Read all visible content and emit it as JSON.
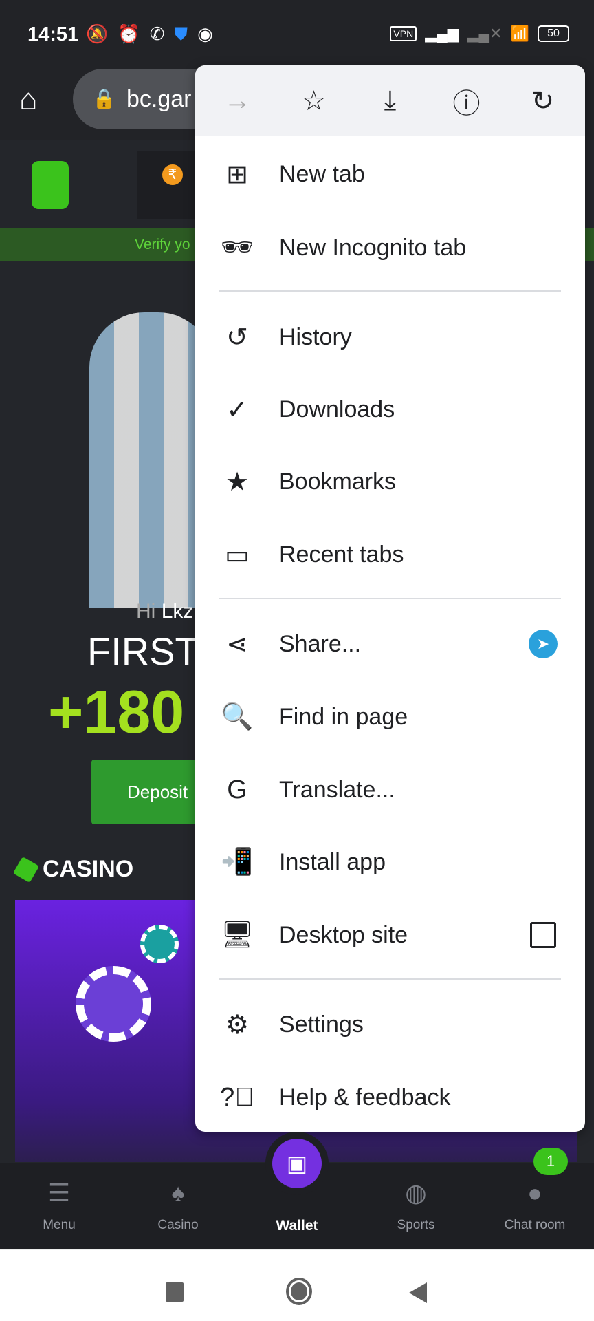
{
  "status_bar": {
    "time": "14:51",
    "vpn": "VPN",
    "battery": "50",
    "left_icons": [
      "mute-bell-icon",
      "alarm-icon",
      "whatsapp-icon",
      "shield-icon",
      "chrome-icon"
    ]
  },
  "browser": {
    "url": "bc.gar"
  },
  "site": {
    "verify_text": "Verify yo",
    "greeting_hi": "Hi",
    "greeting_name": "Lkz",
    "headline": "FIRST",
    "bonus": "+180",
    "deposit_label": "Deposit",
    "section_title": "CASINO",
    "colors": {
      "brand_green": "#3bc31c",
      "bonus_lime": "#a4e01f",
      "wallet_purple": "#7430e0"
    }
  },
  "menu": {
    "toolbar": [
      "forward-icon",
      "bookmark-star-icon",
      "download-icon",
      "info-icon",
      "reload-icon"
    ],
    "items": [
      {
        "label": "New tab",
        "icon": "new-tab-icon"
      },
      {
        "label": "New Incognito tab",
        "icon": "incognito-icon"
      },
      {
        "label": "History",
        "icon": "history-icon"
      },
      {
        "label": "Downloads",
        "icon": "downloads-icon"
      },
      {
        "label": "Bookmarks",
        "icon": "bookmarks-icon"
      },
      {
        "label": "Recent tabs",
        "icon": "recent-tabs-icon"
      },
      {
        "label": "Share...",
        "icon": "share-icon"
      },
      {
        "label": "Find in page",
        "icon": "find-in-page-icon"
      },
      {
        "label": "Translate...",
        "icon": "translate-icon"
      },
      {
        "label": "Install app",
        "icon": "install-app-icon"
      },
      {
        "label": "Desktop site",
        "icon": "desktop-icon",
        "checked": false
      },
      {
        "label": "Settings",
        "icon": "settings-icon"
      },
      {
        "label": "Help & feedback",
        "icon": "help-icon"
      }
    ]
  },
  "bottom_nav": [
    {
      "label": "Menu"
    },
    {
      "label": "Casino"
    },
    {
      "label": "Wallet",
      "active": true
    },
    {
      "label": "Sports"
    },
    {
      "label": "Chat room",
      "badge": "1"
    }
  ]
}
